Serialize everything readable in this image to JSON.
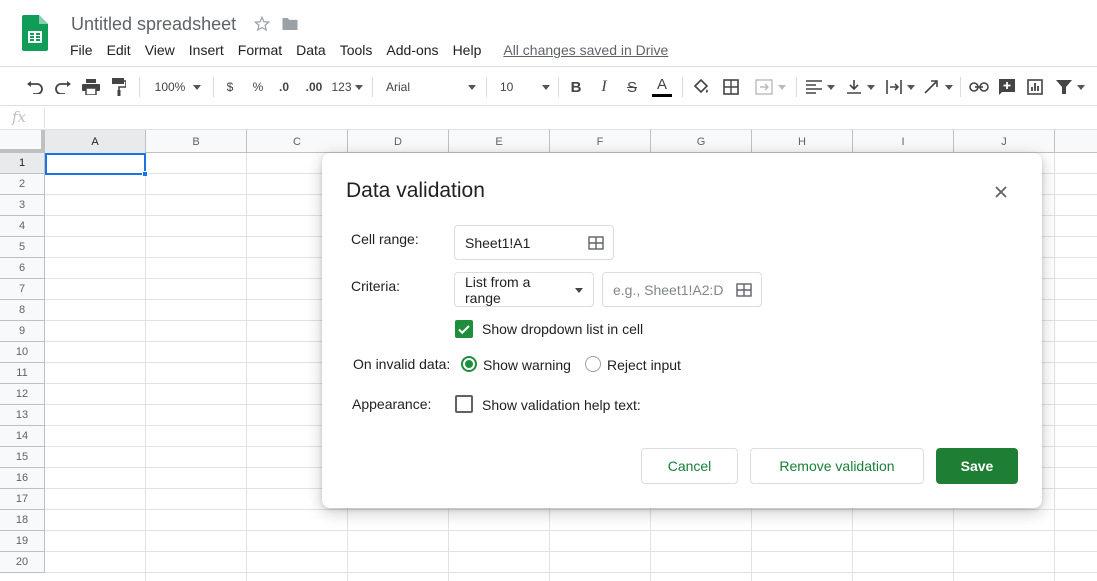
{
  "app": {
    "doc_title": "Untitled spreadsheet",
    "saved_status": "All changes saved in Drive",
    "menu": [
      "File",
      "Edit",
      "View",
      "Insert",
      "Format",
      "Data",
      "Tools",
      "Add-ons",
      "Help"
    ]
  },
  "toolbar": {
    "zoom": "100%",
    "currency": "$",
    "percent": "%",
    "decrease_decimal": ".0",
    "increase_decimal": ".00",
    "more_formats": "123",
    "font": "Arial",
    "font_size": "10",
    "bold": "B",
    "italic": "I",
    "strike": "S",
    "text_color_glyph": "A"
  },
  "formula_bar": {
    "fx": "fx",
    "value": ""
  },
  "grid": {
    "columns": [
      "A",
      "B",
      "C",
      "D",
      "E",
      "F",
      "G",
      "H",
      "I",
      "J"
    ],
    "rows": [
      "1",
      "2",
      "3",
      "4",
      "5",
      "6",
      "7",
      "8",
      "9",
      "10",
      "11",
      "12",
      "13",
      "14",
      "15",
      "16",
      "17",
      "18",
      "19",
      "20"
    ],
    "selected_cell": "A1"
  },
  "dialog": {
    "title": "Data validation",
    "cell_range_label": "Cell range:",
    "cell_range_value": "Sheet1!A1",
    "criteria_label": "Criteria:",
    "criteria_value": "List from a range",
    "criteria_range_placeholder": "e.g., Sheet1!A2:D",
    "show_dropdown_label": "Show dropdown list in cell",
    "show_dropdown_checked": true,
    "invalid_label": "On invalid data:",
    "show_warning_label": "Show warning",
    "reject_input_label": "Reject input",
    "invalid_selected": "Show warning",
    "appearance_label": "Appearance:",
    "help_text_label": "Show validation help text:",
    "help_text_checked": false,
    "cancel": "Cancel",
    "remove": "Remove validation",
    "save": "Save"
  },
  "colors": {
    "accent_green": "#1e8e3e",
    "save_green": "#1e7e34",
    "selection_blue": "#1a73e8"
  }
}
